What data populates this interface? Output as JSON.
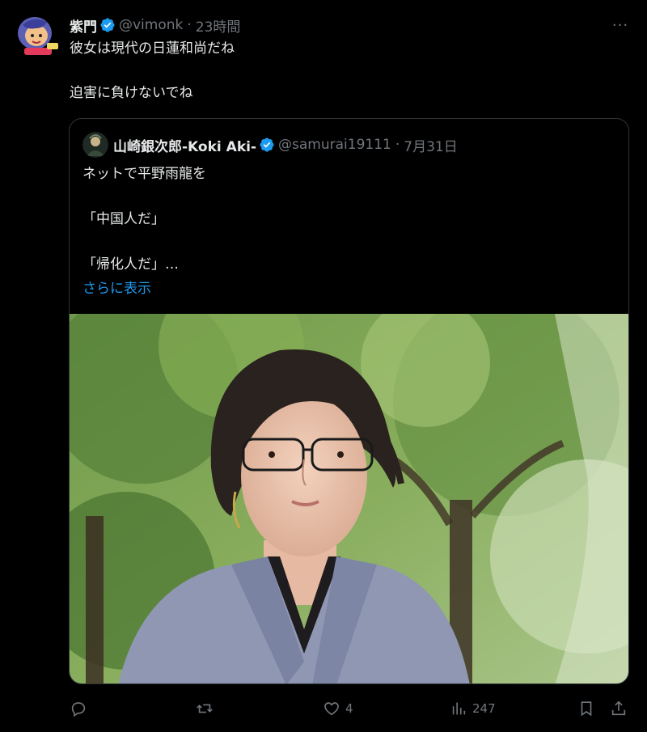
{
  "tweet": {
    "author_name": "紫門",
    "handle": "@vimonk",
    "separator": "·",
    "time": "23時間",
    "more_label": "···",
    "text_line1": "彼女は現代の日蓮和尚だね",
    "text_line2": "迫害に負けないでね"
  },
  "quoted": {
    "author_name": "山崎銀次郎-Koki Aki-",
    "handle": "@samurai19111",
    "separator": "·",
    "time": "7月31日",
    "lines": [
      "ネットで平野雨龍を",
      "「中国人だ」",
      "「帰化人だ」…"
    ],
    "show_more": "さらに表示"
  },
  "actions": {
    "reply_count": "",
    "retweet_count": "",
    "like_count": "4",
    "views_count": "247"
  },
  "colors": {
    "background": "#000000",
    "text": "#e7e9ea",
    "muted": "#71767b",
    "accent": "#1d9bf0",
    "border": "#2f3336"
  },
  "icons": [
    "verified-badge-icon",
    "more-icon",
    "reply-icon",
    "retweet-icon",
    "like-icon",
    "views-icon",
    "bookmark-icon",
    "share-icon"
  ]
}
